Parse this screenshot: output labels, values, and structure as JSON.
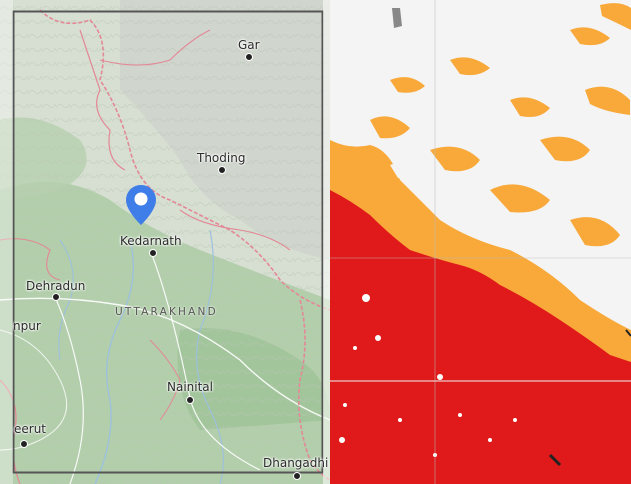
{
  "left_map": {
    "places": {
      "gar": "Gar",
      "thoding": "Thoding",
      "kedarnath": "Kedarnath",
      "dehradun": "Dehradun",
      "uttarakhand": "UTTARAKHAND",
      "nainital": "Nainital",
      "kanpur_partial": "npur",
      "meerut_partial": "eerut",
      "dhangadhi": "Dhangadhi"
    },
    "marker": {
      "icon": "map-pin-icon",
      "color": "#3f7ee8"
    },
    "colors": {
      "terrain": "#cfdcc9",
      "forest": "#9fc29a",
      "border": "#e07a8c",
      "frame": "#555555"
    }
  },
  "right_map": {
    "legend_colors": {
      "snow": "#f4f4f4",
      "partial": "#f8a93a",
      "no_snow": "#e01a1a"
    }
  }
}
